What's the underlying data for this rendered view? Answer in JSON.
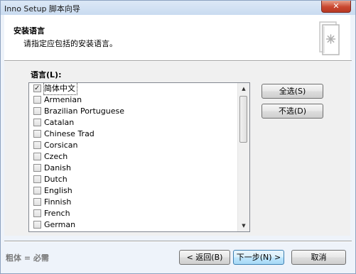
{
  "window": {
    "title": "Inno Setup 脚本向导",
    "close_glyph": "✕"
  },
  "header": {
    "title": "安装语言",
    "subtitle": "请指定应包括的安装语言。",
    "icon": "book-gear-icon"
  },
  "languages": {
    "label": "语言(L):",
    "items": [
      {
        "label": "简体中文",
        "checked": true,
        "selected": true
      },
      {
        "label": "Armenian",
        "checked": false
      },
      {
        "label": "Brazilian Portuguese",
        "checked": false
      },
      {
        "label": "Catalan",
        "checked": false
      },
      {
        "label": "Chinese Trad",
        "checked": false
      },
      {
        "label": "Corsican",
        "checked": false
      },
      {
        "label": "Czech",
        "checked": false
      },
      {
        "label": "Danish",
        "checked": false
      },
      {
        "label": "Dutch",
        "checked": false
      },
      {
        "label": "English",
        "checked": false
      },
      {
        "label": "Finnish",
        "checked": false
      },
      {
        "label": "French",
        "checked": false
      },
      {
        "label": "German",
        "checked": false
      }
    ]
  },
  "buttons": {
    "select_all": "全选(S)",
    "select_none": "不选(D)",
    "back": "< 返回(B)",
    "next": "下一步(N) >",
    "cancel": "取消"
  },
  "footer": {
    "legend": "粗体 = 必需"
  }
}
